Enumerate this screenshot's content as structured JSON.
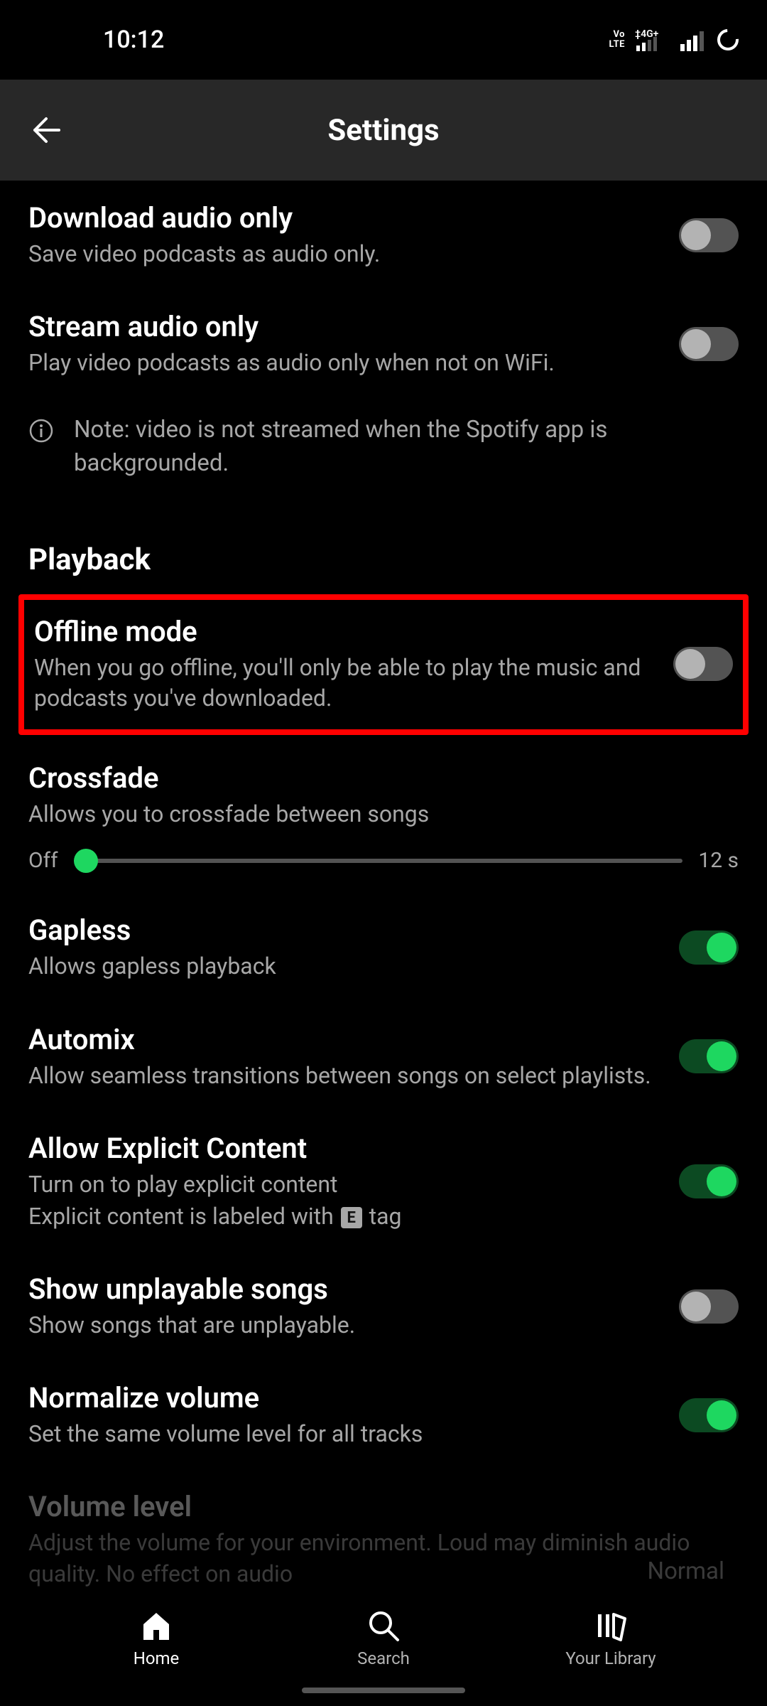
{
  "status": {
    "time": "10:12",
    "volte": "VoLTE",
    "net": "4G+"
  },
  "header": {
    "title": "Settings"
  },
  "items": {
    "download_audio": {
      "title": "Download audio only",
      "sub": "Save video podcasts as audio only.",
      "on": false
    },
    "stream_audio": {
      "title": "Stream audio only",
      "sub": "Play video podcasts as audio only when not on WiFi.",
      "on": false
    },
    "note": "Note: video is not streamed when the Spotify app is backgrounded.",
    "section_playback": "Playback",
    "offline": {
      "title": "Offline mode",
      "sub": "When you go offline, you'll only be able to play the music and podcasts you've downloaded.",
      "on": false
    },
    "crossfade": {
      "title": "Crossfade",
      "sub": "Allows you to crossfade between songs",
      "min_label": "Off",
      "max_label": "12 s",
      "value_pct": 2
    },
    "gapless": {
      "title": "Gapless",
      "sub": "Allows gapless playback",
      "on": true
    },
    "automix": {
      "title": "Automix",
      "sub": "Allow seamless transitions between songs on select playlists.",
      "on": true
    },
    "explicit": {
      "title": "Allow Explicit Content",
      "sub1": "Turn on to play explicit content",
      "sub2a": "Explicit content is labeled with ",
      "sub2b": " tag",
      "tag": "E",
      "on": true
    },
    "unplayable": {
      "title": "Show unplayable songs",
      "sub": "Show songs that are unplayable.",
      "on": false
    },
    "normalize": {
      "title": "Normalize volume",
      "sub": "Set the same volume level for all tracks",
      "on": true
    },
    "volume_level": {
      "title": "Volume level",
      "sub": "Adjust the volume for your environment. Loud may diminish audio quality. No effect on audio",
      "value": "Normal"
    }
  },
  "nav": {
    "home": "Home",
    "search": "Search",
    "library": "Your Library"
  }
}
